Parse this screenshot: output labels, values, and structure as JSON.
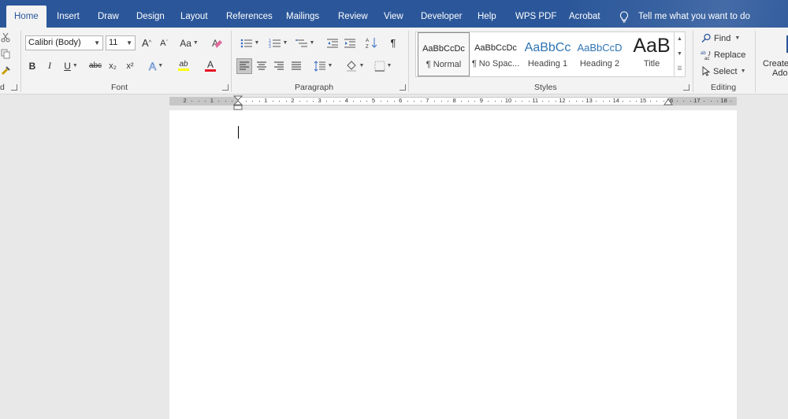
{
  "tabs": [
    "Home",
    "Insert",
    "Draw",
    "Design",
    "Layout",
    "References",
    "Mailings",
    "Review",
    "View",
    "Developer",
    "Help",
    "WPS PDF",
    "Acrobat"
  ],
  "tell_me": "Tell me what you want to do",
  "clipboard": {
    "label": "d"
  },
  "font": {
    "family": "Calibri (Body)",
    "size": "11",
    "grow_label": "A",
    "shrink_label": "A",
    "case_label": "Aa",
    "bold": "B",
    "italic": "I",
    "underline": "U",
    "strike": "abc",
    "subscript": "x₂",
    "superscript": "x²",
    "effects": "A",
    "highlight": "ab",
    "font_color": "A",
    "group_label": "Font"
  },
  "paragraph": {
    "group_label": "Paragraph",
    "pilcrow": "¶"
  },
  "styles": {
    "items": [
      {
        "preview": "AaBbCcDc",
        "name": "¶ Normal"
      },
      {
        "preview": "AaBbCcDc",
        "name": "¶ No Spac..."
      },
      {
        "preview": "AaBbCc",
        "name": "Heading 1"
      },
      {
        "preview": "AaBbCcD",
        "name": "Heading 2"
      },
      {
        "preview": "AaB",
        "name": "Title"
      }
    ],
    "group_label": "Styles"
  },
  "editing": {
    "find": "Find",
    "replace": "Replace",
    "select": "Select",
    "group_label": "Editing"
  },
  "adobe": {
    "line1": "Create",
    "line2": "Ado"
  },
  "ruler": {
    "numbers": [
      "2",
      "1",
      "1",
      "2",
      "3",
      "4",
      "5",
      "6",
      "7",
      "8",
      "9",
      "10",
      "11",
      "12",
      "13",
      "14",
      "15",
      "16",
      "17",
      "18"
    ]
  },
  "colors": {
    "tabbar": "#2b579a",
    "ribbon": "#f3f3f3",
    "font_color_bar": "#e81123",
    "highlight_bar": "#ffff00"
  }
}
